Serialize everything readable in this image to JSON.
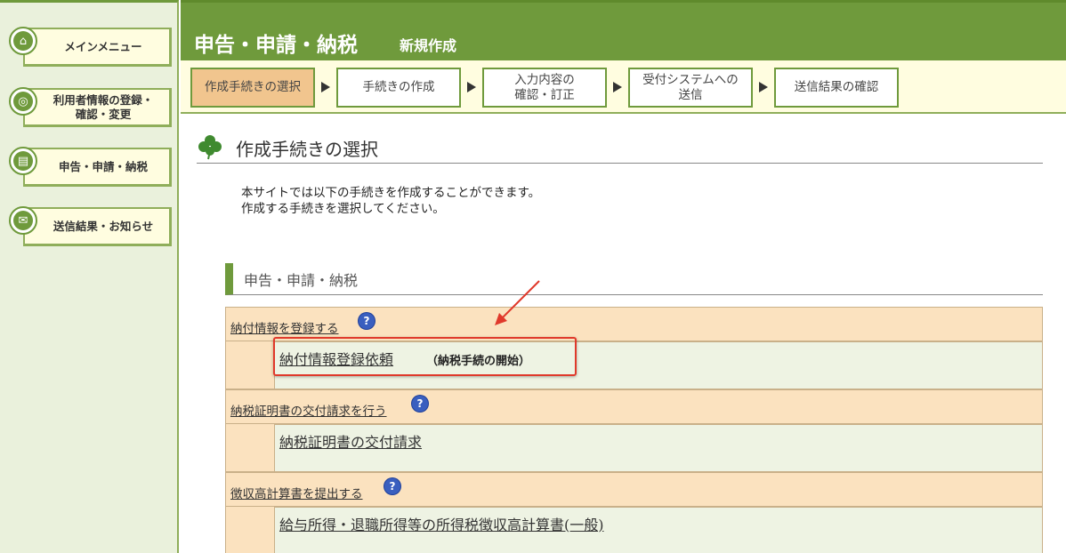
{
  "sidebar": {
    "items": [
      {
        "label": "メインメニュー",
        "icon": "home-icon"
      },
      {
        "label": "利用者情報の登録・\n確認・変更",
        "icon": "settings-icon"
      },
      {
        "label": "申告・申請・納税",
        "icon": "document-icon"
      },
      {
        "label": "送信結果・お知らせ",
        "icon": "mail-icon"
      }
    ]
  },
  "header": {
    "title": "申告・申請・納税",
    "subtitle": "新規作成"
  },
  "steps": [
    {
      "label": "作成手続きの選択",
      "active": true
    },
    {
      "label": "手続きの作成",
      "active": false
    },
    {
      "label": "入力内容の\n確認・訂正",
      "active": false
    },
    {
      "label": "受付システムへの\n送信",
      "active": false
    },
    {
      "label": "送信結果の確認",
      "active": false
    }
  ],
  "main": {
    "section_title": "作成手続きの選択",
    "intro_line1": "本サイトでは以下の手続きを作成することができます。",
    "intro_line2": "作成する手続きを選択してください。",
    "category_title": "申告・申請・納税",
    "groups": [
      {
        "heading": "納付情報を登録する",
        "link": "納付情報登録依頼",
        "note": "（納税手続の開始）"
      },
      {
        "heading": "納税証明書の交付請求を行う",
        "link": "納税証明書の交付請求",
        "note": ""
      },
      {
        "heading": "徴収高計算書を提出する",
        "link": "給与所得・退職所得等の所得税徴収高計算書(一般)",
        "note": ""
      }
    ]
  },
  "colors": {
    "brand_green": "#6f9a3c",
    "sidebar_bg": "#eaf1dc",
    "active_step": "#f1c58e",
    "group_head_bg": "#fbe2bf",
    "highlight_red": "#e0392b"
  }
}
